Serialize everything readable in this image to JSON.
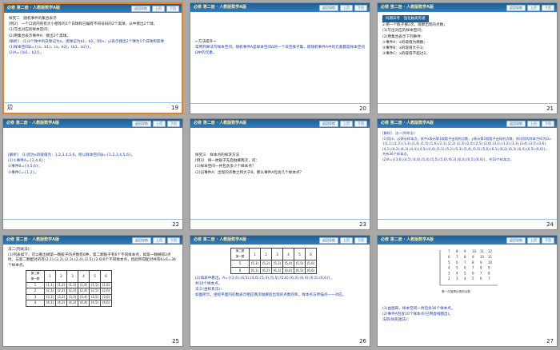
{
  "header": {
    "title": "必修 第二册 · 人教版数学A版",
    "buttons": [
      "返回导航",
      "上页",
      "下页"
    ]
  },
  "slides": [
    {
      "number": "19",
      "lines": [
        "探究二　随机事件的集合表示",
        "[例2]　一个口袋内装有大小相等的1个白球和已编有不同号码的2个黑球，从中摸出2个球。",
        "(1)写出对应的样本空间；",
        "(2)用集合表示事件A：摸出2个黑球。",
        "[解析]　(1)3个球中的白球记为a，黑球记为b1，b2，则(x，y)表示摸出2个球为1个白球和黑球",
        "(1)样本空间Ω={(a，b1)，(a，b2)，(b1，b2)}。",
        "(2)A={(b1，b2)}。"
      ]
    },
    {
      "number": "20",
      "lines": [
        "←方法提升→",
        "常用列举法写样本空间，随机事件A是样本空间Ω的一个非空真子集，即随机事件A中的元素都是样本空间Ω中的元素。"
      ]
    },
    {
      "number": "21",
      "lines": [
        "同源异考　强化触类旁通",
        "2.把一个骰子掷2次，观察出现的点数，",
        "(1)写出对应的样本空间；",
        "(2)用集合表示下列事件：",
        "①事件A：x的取值为偶数；",
        "②事件B：x的取值大于3；",
        "③事件C：x的取值不超过2。"
      ]
    },
    {
      "number": "22",
      "lines": [
        "[解析]　(1)因为x的取值为：1,2,3,4,5,6，所以样本空间Ω={1,2,3,4,5,6}。",
        "(2)①事件A={2,4,6}；",
        "②事件B={4,5,6}；",
        "③事件C={1,2}。"
      ]
    },
    {
      "number": "23",
      "lines": [
        "探究三　样本点的探求方法",
        "[例3]　将一枚骰子先后抛掷两次，问：",
        "(1)样本空间一共包含多少个样本点？",
        "(2)记事件A：出现的点数之和大于8，那么事件A包含几个样本点？"
      ]
    },
    {
      "number": "24",
      "lines": [
        "[解析]　法一(列举法)：",
        "(1)用(x，y)表示样本点，其中x表示第1枚骰子出现的点数，y表示第2枚骰子出现的点数，则试验的样本空间为Ω={(1,1),(1,2),(1,3),(1,4),(1,5),(1,6),(2,1),(2,2),(2,3),(2,4),(2,5),(2,6),(3,1),(3,2),(3,3),(3,4),(3,5),(3,6),(4,1),(4,2),(4,3),(4,4),(4,5),(4,6),(5,1),(5,2),(5,3),(5,4),(5,5),(5,6),(6,1),(6,2),(6,3),(6,4),(6,5),(6,6)}，",
        "共有36个样本点。",
        "(2)A={(3,6),(4,5),(4,6),(5,4),(5,5),(5,6),(6,3),(6,4),(6,5),(6,6)}，共10个样本点。"
      ]
    },
    {
      "number": "25",
      "lines": [
        "法二(列表法)：",
        "(1)列表如下，可以看出掷第一颗骰子的点数有6种，第二颗骰子有6个不同样本点，如第一颗掷得2点时，与第二颗配对的有(2,1),(2,2),(2,3),(2,4),(2,5),(2,6)6个不同样本点，因此所得配对共有6×6=36个样本点。"
      ],
      "table": {
        "corner_top": "第二颗",
        "corner_bottom": "第一颗",
        "cols": [
          "1",
          "2",
          "3",
          "4",
          "5",
          "6"
        ],
        "rows": [
          [
            "1",
            "(1,1)",
            "(1,2)",
            "(1,3)",
            "(1,4)",
            "(1,5)",
            "(1,6)"
          ],
          [
            "2",
            "(2,1)",
            "(2,2)",
            "(2,3)",
            "(2,4)",
            "(2,5)",
            "(2,6)"
          ],
          [
            "3",
            "(3,1)",
            "(3,2)",
            "(3,3)",
            "(3,4)",
            "(3,5)",
            "(3,6)"
          ],
          [
            "4",
            "(4,1)",
            "(4,2)",
            "(4,3)",
            "(4,4)",
            "(4,5)",
            "(4,6)"
          ]
        ]
      }
    },
    {
      "number": "26",
      "lines": [
        "(2)如表中看出，A={(3,6),(4,5),(4,6),(5,4),(5,5),(5,6),(6,3),(6,4),(6,5),(6,6)}，",
        "共10个样本点。",
        "法三(坐标系法)：",
        "如图所示，坐标平面内的数表示相应两次抛掷后出现的点数的和，样本点与所描点一一对应。"
      ],
      "table": {
        "corner_top": "第二颗",
        "corner_bottom": "第一颗",
        "cols": [
          "1",
          "2",
          "3",
          "4",
          "5",
          "6"
        ],
        "rows": [
          [
            "5",
            "(5,1)",
            "(5,2)",
            "(5,3)",
            "(5,4)",
            "(5,5)",
            "(5,6)"
          ],
          [
            "6",
            "(6,1)",
            "(6,2)",
            "(6,3)",
            "(6,4)",
            "(6,5)",
            "(6,6)"
          ]
        ]
      }
    },
    {
      "number": "27",
      "lines": [
        "(1)由图知，样本空间一共包含36个样本点。",
        "(2)事件A包含10个样本点(已用虚线圈出)。",
        "法四(树形图法)："
      ],
      "grid_caption": "第一次抛掷出现的点数"
    }
  ],
  "left_num": "边"
}
